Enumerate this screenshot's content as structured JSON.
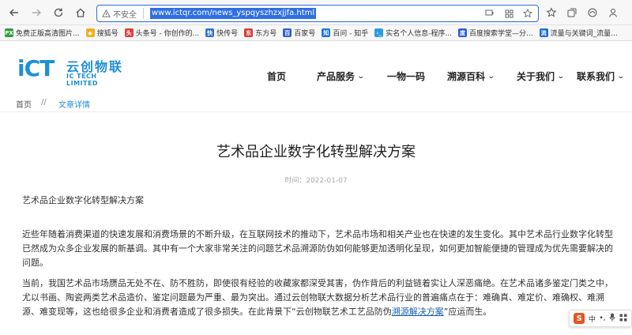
{
  "browser": {
    "security_label": "不安全",
    "url": "www.ictqr.com/news_yspqyszhzxjjfa.html",
    "bookmarks": [
      {
        "label": "免费正版高清图片...",
        "icon": "image-icon",
        "color": "#2e9e3e",
        "glyph": "PX"
      },
      {
        "label": "搜狐号",
        "icon": "sohu-icon",
        "color": "#f2b01c",
        "glyph": "◆"
      },
      {
        "label": "头条号 - 你创作的...",
        "icon": "toutiao-icon",
        "color": "#e33b3b",
        "glyph": "头"
      },
      {
        "label": "快传号",
        "icon": "kuaichuan-icon",
        "color": "#3070e0",
        "glyph": "快"
      },
      {
        "label": "东方号",
        "icon": "dongfang-icon",
        "color": "#d83b3b",
        "glyph": "东"
      },
      {
        "label": "百家号",
        "icon": "baijia-icon",
        "color": "#2f5fd8",
        "glyph": "百"
      },
      {
        "label": "百问 - 知乎",
        "icon": "zhihu-icon",
        "color": "#1a74e8",
        "glyph": "知"
      },
      {
        "label": "实名个人信息-程序...",
        "icon": "program-icon",
        "color": "#2a9de0",
        "glyph": "›_"
      },
      {
        "label": "百度搜索学堂—分...",
        "icon": "baidu-icon",
        "color": "#2d5be3",
        "glyph": "度"
      },
      {
        "label": "流量与关键词_流量...",
        "icon": "traffic-icon",
        "color": "#1d6fd8",
        "glyph": "流"
      }
    ]
  },
  "site": {
    "logo_mark": "iCT",
    "logo_cn": "云创物联",
    "logo_en": "IC TECH LIMITED",
    "nav": [
      {
        "label": "首页",
        "has_dropdown": false
      },
      {
        "label": "产品服务",
        "has_dropdown": true
      },
      {
        "label": "一物一码",
        "has_dropdown": false
      },
      {
        "label": "溯源百科",
        "has_dropdown": true
      },
      {
        "label": "关于我们",
        "has_dropdown": true
      },
      {
        "label": "联系我们",
        "has_dropdown": true
      }
    ],
    "breadcrumb": {
      "home": "首页",
      "separator": "//",
      "current": "文章详情"
    },
    "accent_color": "#1e8fd6"
  },
  "article": {
    "title": "艺术品企业数字化转型解决方案",
    "date": "时间：2022-01-07",
    "p1": "艺术品企业数字化转型解决方案",
    "p2": "近些年随着消费渠道的快速发展和消费场景的不断升级，在互联网技术的推动下，艺术品市场和相关产业也在快速的发生变化。其中艺术品行业数字化转型已然成为众多企业发展的新基调。其中有一个大家非常关注的问题艺术品溯源防伪如何能够更加透明化呈现，如何更加智能便捷的管理成为优先需要解决的问题。",
    "p3_before": "当前，我国艺术品市场赝品无处不在、防不胜防，即使很有经验的收藏家都深受其害，伪作背后的利益链着实让人深恶痛绝。在艺术品诸多鉴定门类之中，尤以书画、陶瓷两类艺术品造价、鉴定问题最为严重、最为突出。通过云创物联大数据分析艺术品行业的普遍痛点在于：难确真、难定价、难确权、难溯源、难变现等，这也给很多企业和消费者造成了很多损失。在此背景下“云创物联艺术工艺品防伪",
    "p3_link": "溯源解决方案",
    "p3_after": "”应运而生。"
  },
  "ime": {
    "logo": "S",
    "mode": "中",
    "punct": "•,",
    "mic": "mic-icon",
    "grid": "grid-icon"
  }
}
